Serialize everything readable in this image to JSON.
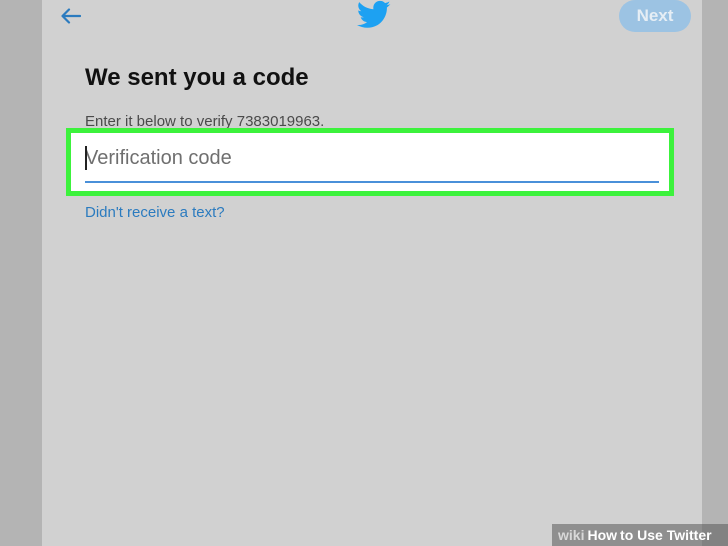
{
  "colors": {
    "accent": "#1da1f2",
    "link": "#2b7bbf",
    "highlight": "#3cf23c",
    "next_button_bg": "#9cc3e3"
  },
  "header": {
    "back_icon": "arrow-left-icon",
    "logo_icon": "twitter-bird-icon",
    "next_label": "Next"
  },
  "main": {
    "title": "We sent you a code",
    "instruction": "Enter it below to verify 7383019963.",
    "code_input": {
      "placeholder": "Verification code",
      "value": ""
    },
    "resend_link": "Didn't receive a text?"
  },
  "watermark": {
    "wiki": "wiki",
    "how": "How",
    "rest": "to Use Twitter"
  }
}
